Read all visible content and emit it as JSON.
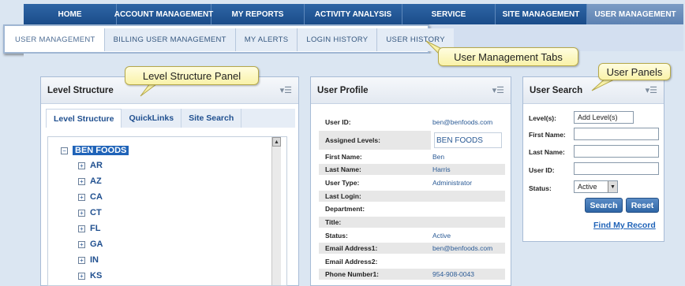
{
  "nav": {
    "items": [
      "HOME",
      "ACCOUNT MANAGEMENT",
      "MY REPORTS",
      "ACTIVITY ANALYSIS",
      "SERVICE",
      "SITE MANAGEMENT",
      "USER MANAGEMENT"
    ],
    "active": "USER MANAGEMENT"
  },
  "subtabs": {
    "items": [
      "USER MANAGEMENT",
      "BILLING USER MANAGEMENT",
      "MY ALERTS",
      "LOGIN HISTORY",
      "USER HISTORY"
    ],
    "active": "USER MANAGEMENT"
  },
  "callouts": {
    "tabs": "User Management Tabs",
    "level_panel": "Level Structure Panel",
    "user_panels": "User Panels"
  },
  "level_structure": {
    "title": "Level Structure",
    "tabs": [
      "Level Structure",
      "QuickLinks",
      "Site Search"
    ],
    "root": "BEN FOODS",
    "nodes": [
      "AR",
      "AZ",
      "CA",
      "CT",
      "FL",
      "GA",
      "IN",
      "KS"
    ],
    "menu_icon": "panel-menu-icon"
  },
  "user_profile": {
    "title": "User Profile",
    "user_id_label": "User ID:",
    "user_id": "ben@benfoods.com",
    "assigned_label": "Assigned Levels:",
    "assigned_value": "BEN FOODS",
    "first_name_label": "First Name:",
    "first_name": "Ben",
    "last_name_label": "Last Name:",
    "last_name": "Harris",
    "user_type_label": "User Type:",
    "user_type": "Administrator",
    "last_login_label": "Last Login:",
    "last_login": "",
    "department_label": "Department:",
    "department": "",
    "title_label": "Title:",
    "title_value": "",
    "status_label": "Status:",
    "status": "Active",
    "email1_label": "Email Address1:",
    "email1": "ben@benfoods.com",
    "email2_label": "Email Address2:",
    "email2": "",
    "phone1_label": "Phone Number1:",
    "phone1": "954-908-0043"
  },
  "user_search": {
    "title": "User Search",
    "levels_label": "Level(s):",
    "levels_value": "Add Level(s)",
    "first_name_label": "First Name:",
    "last_name_label": "Last Name:",
    "user_id_label": "User ID:",
    "status_label": "Status:",
    "status_value": "Active",
    "search_button": "Search",
    "reset_button": "Reset",
    "find_link": "Find My Record"
  },
  "colors": {
    "nav_bg": "#1f56a0",
    "accent": "#1f63b8",
    "callout_bg": "#f9f2a8"
  }
}
